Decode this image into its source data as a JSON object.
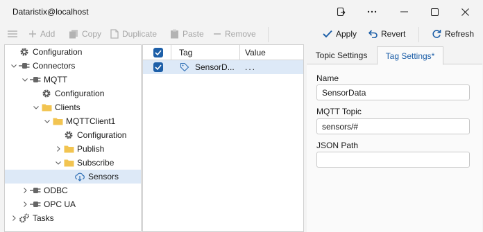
{
  "window": {
    "title": "Dataristix@localhost"
  },
  "toolbar": {
    "add_label": "Add",
    "copy_label": "Copy",
    "duplicate_label": "Duplicate",
    "paste_label": "Paste",
    "remove_label": "Remove",
    "apply_label": "Apply",
    "revert_label": "Revert",
    "refresh_label": "Refresh"
  },
  "tree": {
    "items": [
      {
        "label": "Configuration",
        "icon": "gear-icon"
      },
      {
        "label": "Connectors",
        "icon": "plug-icon"
      },
      {
        "label": "MQTT",
        "icon": "plug-icon"
      },
      {
        "label": "Configuration",
        "icon": "gear-icon"
      },
      {
        "label": "Clients",
        "icon": "folder-icon"
      },
      {
        "label": "MQTTClient1",
        "icon": "folder-icon"
      },
      {
        "label": "Configuration",
        "icon": "gear-icon"
      },
      {
        "label": "Publish",
        "icon": "folder-icon"
      },
      {
        "label": "Subscribe",
        "icon": "folder-icon"
      },
      {
        "label": "Sensors",
        "icon": "cloud-download-icon"
      },
      {
        "label": "ODBC",
        "icon": "plug-icon"
      },
      {
        "label": "OPC UA",
        "icon": "plug-icon"
      },
      {
        "label": "Tasks",
        "icon": "gears-icon"
      }
    ]
  },
  "grid": {
    "columns": [
      "Tag",
      "Value"
    ],
    "rows": [
      {
        "checked": true,
        "tag": "SensorD...",
        "value": "..."
      }
    ]
  },
  "detail": {
    "tabs": [
      "Topic Settings",
      "Tag Settings*"
    ],
    "active_tab": "Tag Settings*",
    "fields": {
      "name_label": "Name",
      "name_value": "SensorData",
      "topic_label": "MQTT Topic",
      "topic_value": "sensors/#",
      "json_label": "JSON Path",
      "json_value": ""
    }
  },
  "colors": {
    "accent": "#1d5fa8",
    "selection": "#dde9f7",
    "folder": "#f2c451"
  }
}
